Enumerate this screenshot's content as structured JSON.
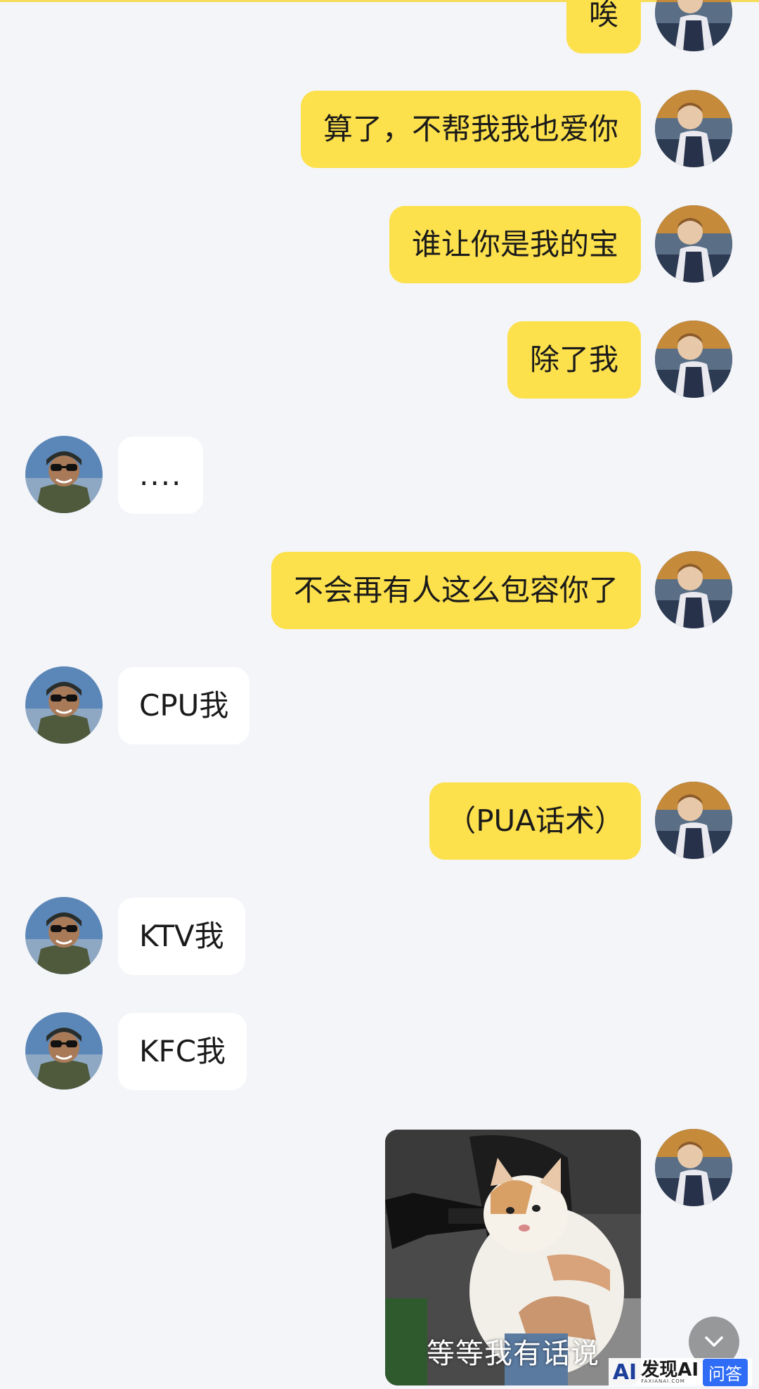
{
  "messages": [
    {
      "side": "right",
      "text": "唉"
    },
    {
      "side": "right",
      "text": "算了，不帮我我也爱你"
    },
    {
      "side": "right",
      "text": "谁让你是我的宝"
    },
    {
      "side": "right",
      "text": "除了我"
    },
    {
      "side": "left",
      "text": "...."
    },
    {
      "side": "right",
      "text": "不会再有人这么包容你了"
    },
    {
      "side": "left",
      "text": "CPU我"
    },
    {
      "side": "right",
      "text": "（PUA话术）"
    },
    {
      "side": "left",
      "text": "KTV我"
    },
    {
      "side": "left",
      "text": "KFC我"
    }
  ],
  "sticker": {
    "caption": "等等我有话说"
  },
  "watermark": {
    "logo": "AI",
    "name": "发现AI",
    "domain": "FAXIANAI.COM",
    "badge": "问答"
  },
  "colors": {
    "background": "#f4f5f9",
    "self_bubble": "#fce04c",
    "other_bubble": "#ffffff",
    "watermark_badge": "#2f6df6"
  },
  "icons": {
    "scroll_button": "chevron-down-icon",
    "self_avatar": "girl-avatar",
    "other_avatar": "pilot-avatar"
  }
}
